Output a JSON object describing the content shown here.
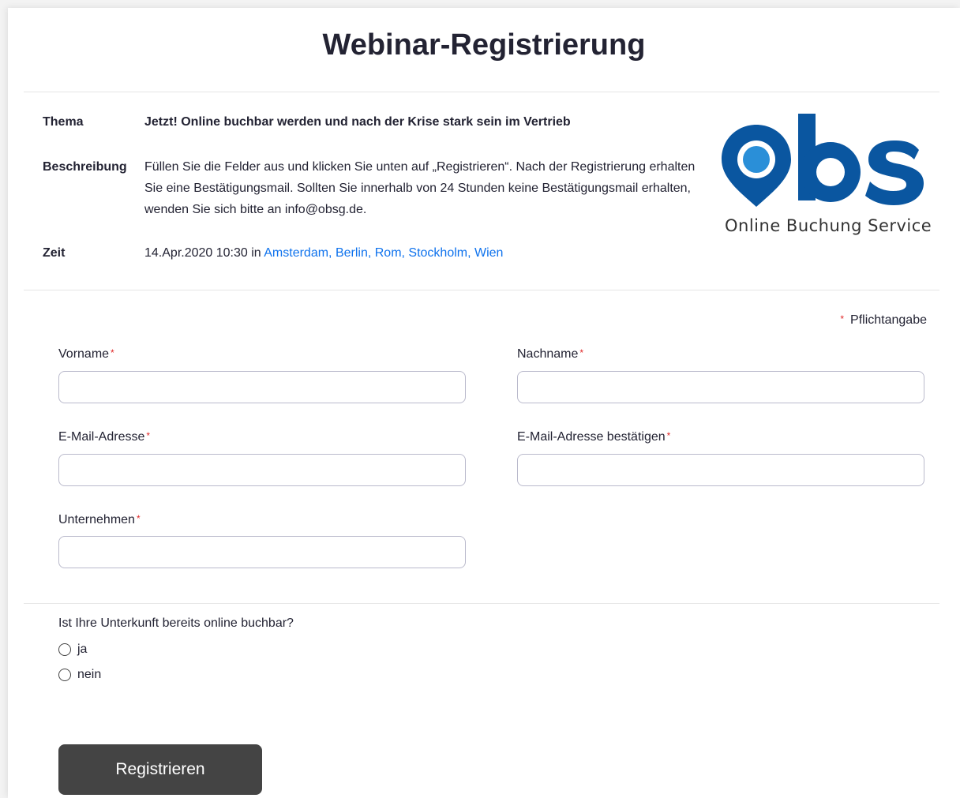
{
  "page": {
    "title": "Webinar-Registrierung"
  },
  "info": {
    "topic_label": "Thema",
    "topic_value": "Jetzt! Online buchbar werden und nach der Krise stark sein im Vertrieb",
    "description_label": "Beschreibung",
    "description_value": "Füllen Sie die Felder aus und klicken Sie unten auf „Registrieren“. Nach der Registrierung erhalten Sie eine Bestätigungsmail. Sollten Sie innerhalb von 24 Stunden keine Bestätigungsmail erhalten, wenden Sie sich bitte an info@obsg.de.",
    "time_label": "Zeit",
    "time_value": "14.Apr.2020 10:30 in ",
    "timezone_link": "Amsterdam, Berlin, Rom, Stockholm, Wien"
  },
  "logo": {
    "wordmark": "obs",
    "tagline": "Online Buchung Service",
    "colors": {
      "brand": "#0a56a0",
      "pin_dot": "#2a8fd8"
    }
  },
  "form": {
    "required_note": "Pflichtangabe",
    "required_marker": "*",
    "fields": {
      "first_name": {
        "label": "Vorname",
        "value": ""
      },
      "last_name": {
        "label": "Nachname",
        "value": ""
      },
      "email": {
        "label": "E-Mail-Adresse",
        "value": ""
      },
      "email_confirm": {
        "label": "E-Mail-Adresse bestätigen",
        "value": ""
      },
      "company": {
        "label": "Unternehmen",
        "value": ""
      }
    },
    "question": {
      "label": "Ist Ihre Unterkunft bereits online buchbar?",
      "options": [
        {
          "label": "ja",
          "selected": false
        },
        {
          "label": "nein",
          "selected": false
        }
      ]
    },
    "submit_label": "Registrieren"
  },
  "colors": {
    "link": "#0e72ed",
    "required": "#e02828",
    "button_bg": "#444444",
    "input_border": "#babacc"
  }
}
